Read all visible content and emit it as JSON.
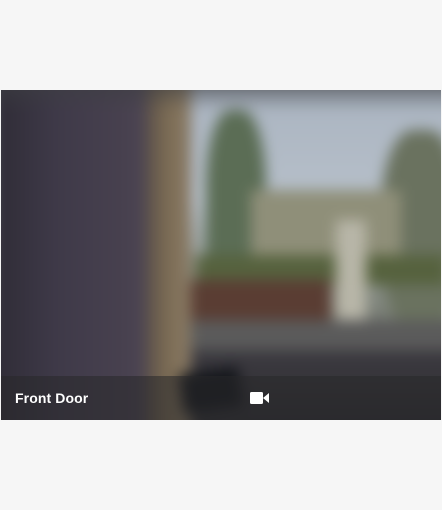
{
  "camera": {
    "name": "Front Door",
    "icon": "video-camera-icon"
  }
}
